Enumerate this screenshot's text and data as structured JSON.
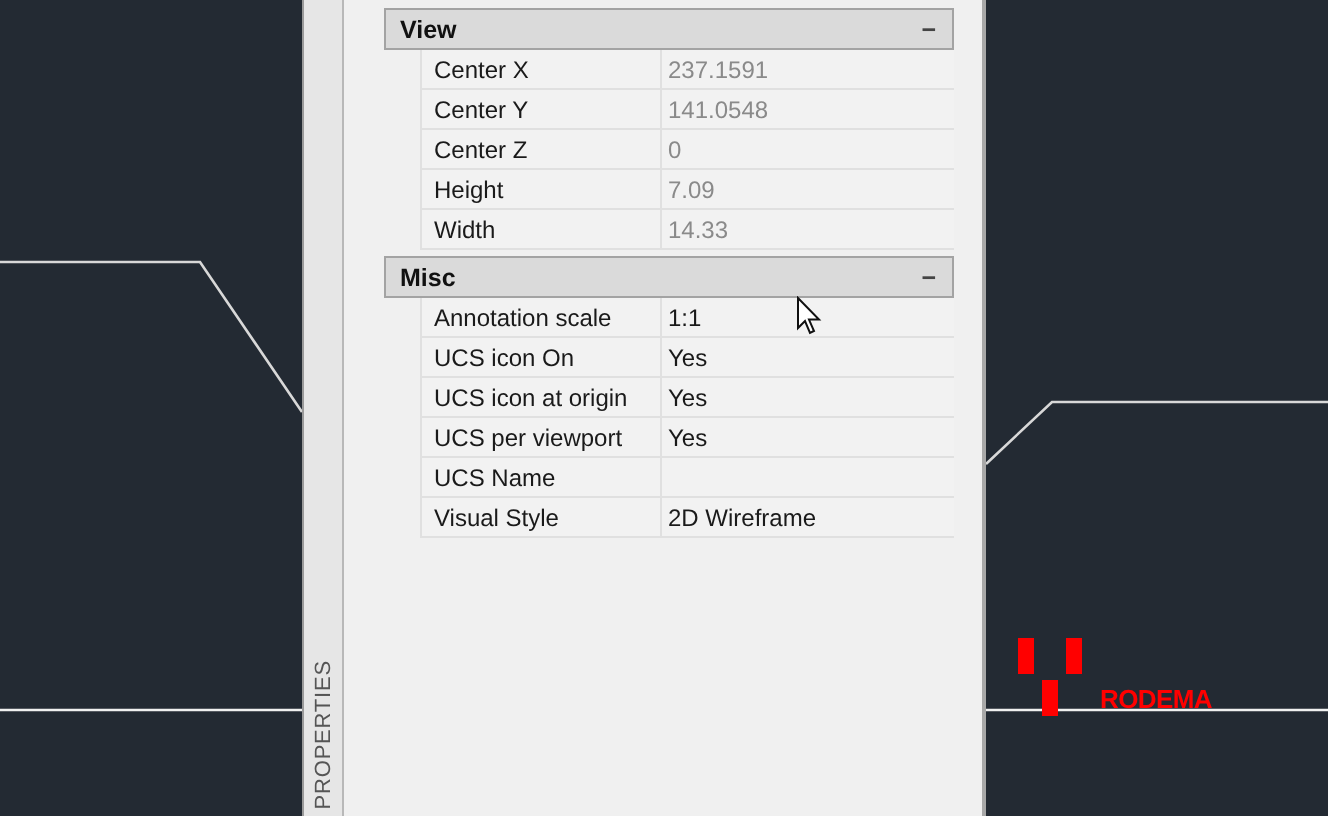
{
  "canvas": {
    "label": "RODEMA"
  },
  "palette": {
    "title": "PROPERTIES",
    "sections": [
      {
        "name": "View",
        "toggle": "−",
        "expanded": true,
        "rows": [
          {
            "label": "Center X",
            "value": "237.1591",
            "readonly": true
          },
          {
            "label": "Center Y",
            "value": "141.0548",
            "readonly": true
          },
          {
            "label": "Center Z",
            "value": "0",
            "readonly": true
          },
          {
            "label": "Height",
            "value": "7.09",
            "readonly": true
          },
          {
            "label": "Width",
            "value": "14.33",
            "readonly": true
          }
        ]
      },
      {
        "name": "Misc",
        "toggle": "−",
        "expanded": true,
        "rows": [
          {
            "label": "Annotation scale",
            "value": "1:1",
            "readonly": false
          },
          {
            "label": "UCS icon On",
            "value": "Yes",
            "readonly": false
          },
          {
            "label": "UCS icon at origin",
            "value": "Yes",
            "readonly": false
          },
          {
            "label": "UCS per viewport",
            "value": "Yes",
            "readonly": false
          },
          {
            "label": "UCS Name",
            "readonly": false
          },
          {
            "label": "Visual Style",
            "value": "2D Wireframe",
            "readonly": false
          }
        ]
      }
    ]
  }
}
